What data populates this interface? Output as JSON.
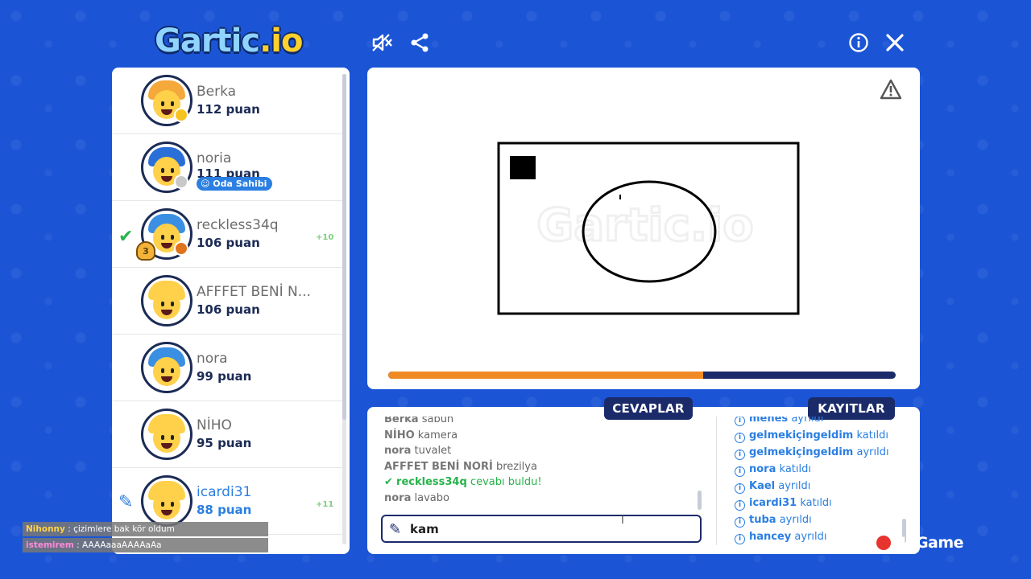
{
  "header": {
    "logo_main": "Gartic",
    "logo_suffix": ".io",
    "icons": [
      "mute-icon",
      "share-icon",
      "info-icon",
      "close-icon"
    ]
  },
  "players": [
    {
      "name": "Berka",
      "score": "112 puan",
      "hair": "#f4a93a",
      "dot": "#f6c323"
    },
    {
      "name": "noria",
      "score": "111 puan",
      "hair": "#2a6fd8",
      "dot": "#c9c9c9",
      "badge": "Oda Sahibi"
    },
    {
      "name": "reckless34q",
      "score": "106 puan",
      "hair": "#3a8fe2",
      "dot": "#e0741d",
      "bonus": "+10",
      "guessed": true,
      "rank": "3"
    },
    {
      "name": "AFFFET BENİ N...",
      "score": "106 puan",
      "hair": "#ffd04a",
      "dot": ""
    },
    {
      "name": "nora",
      "score": "99 puan",
      "hair": "#3a8fe2",
      "dot": ""
    },
    {
      "name": "NİHO",
      "score": "95 puan",
      "hair": "#ffd04a",
      "dot": ""
    },
    {
      "name": "icardi31",
      "score": "88 puan",
      "hair": "#ffd04a",
      "dot": "",
      "bonus": "+11",
      "drawing": true,
      "highlight": true
    }
  ],
  "canvas": {
    "progress": 0.62,
    "colors": {
      "progress_fill": "#f08a24",
      "progress_track": "#1b2b6a"
    }
  },
  "tabs": {
    "answers": "CEVAPLAR",
    "logs": "KAYITLAR"
  },
  "answers": [
    {
      "who": "Berka",
      "text": "sabun"
    },
    {
      "who": "NİHO",
      "text": "kamera"
    },
    {
      "who": "nora",
      "text": "tuvalet"
    },
    {
      "who": "AFFFET BENİ NORİ",
      "text": "brezilya"
    },
    {
      "who": "reckless34q",
      "text": "cevabı buldu!",
      "correct": true
    },
    {
      "who": "nora",
      "text": "lavabo"
    }
  ],
  "logs": [
    {
      "who": "menes",
      "text": "ayrıldı"
    },
    {
      "who": "gelmekiçingeldim",
      "text": "katıldı"
    },
    {
      "who": "gelmekiçingeldim",
      "text": "ayrıldı"
    },
    {
      "who": "nora",
      "text": "katıldı"
    },
    {
      "who": "Kael",
      "text": "ayrıldı"
    },
    {
      "who": "icardi31",
      "text": "katıldı"
    },
    {
      "who": "tuba",
      "text": "ayrıldı"
    },
    {
      "who": "hancey",
      "text": "ayrıldı"
    }
  ],
  "input": {
    "value": "kam"
  },
  "overlay_chat": [
    {
      "name": "Nihonny",
      "text": ": çizimlere bak kör oldum"
    },
    {
      "name": "istemirem",
      "text": ": AAAAaaaAAAAaAa"
    }
  ],
  "watermark": "NoGame"
}
